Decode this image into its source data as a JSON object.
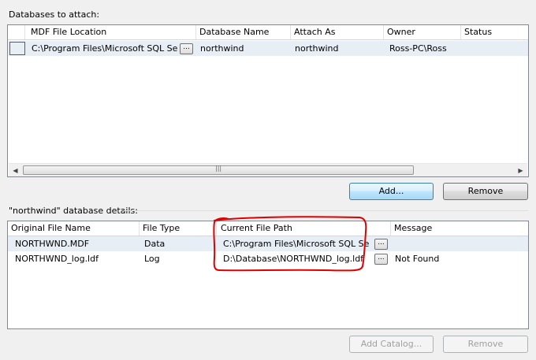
{
  "attach": {
    "label": "Databases to attach:",
    "columns": [
      "MDF File Location",
      "Database Name",
      "Attach As",
      "Owner",
      "Status"
    ],
    "rows": [
      {
        "mdf": "C:\\Program Files\\Microsoft SQL Ser...",
        "db": "northwind",
        "as": "northwind",
        "owner": "Ross-PC\\Ross",
        "status": ""
      }
    ],
    "browse_label": "..."
  },
  "scroll": {
    "left_icon": "scroll-left-arrow",
    "right_icon": "scroll-right-arrow",
    "grip": "|||"
  },
  "buttons": {
    "add": "Add...",
    "remove": "Remove",
    "add_catalog": "Add Catalog...",
    "remove2": "Remove"
  },
  "details": {
    "label": "\"northwind\" database details:",
    "columns": [
      "Original File Name",
      "File Type",
      "Current File Path",
      "Message"
    ],
    "rows": [
      {
        "name": "NORTHWND.MDF",
        "type": "Data",
        "path": "C:\\Program Files\\Microsoft SQL Ser...",
        "message": ""
      },
      {
        "name": "NORTHWND_log.ldf",
        "type": "Log",
        "path": "D:\\Database\\NORTHWND_log.ldf",
        "message": "Not Found"
      }
    ],
    "browse_label": "..."
  },
  "annotation": {
    "color": "#e00000"
  }
}
